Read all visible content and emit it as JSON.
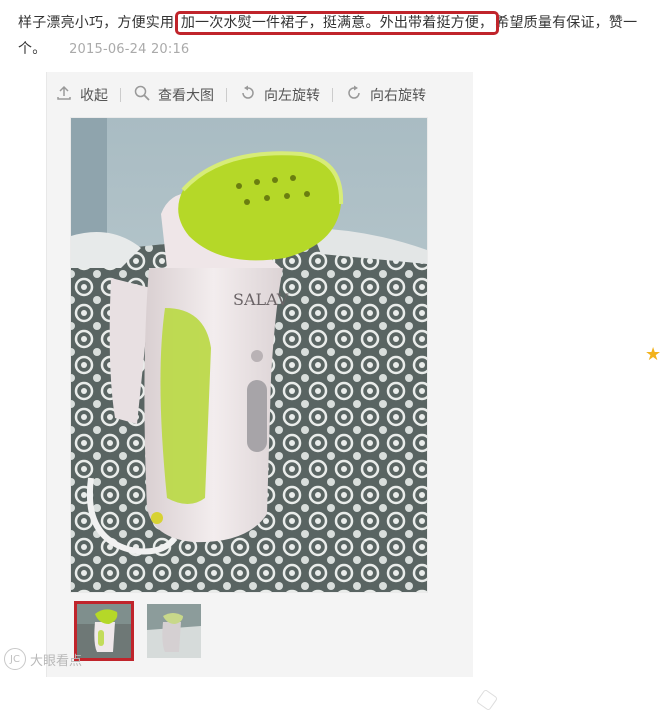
{
  "review": {
    "text_before": "样子漂亮小巧，方便实用",
    "highlight": "加一次水熨一件裙子，挺满意。外出带着挺方便，",
    "text_after": "希望质量有保证，赞一个。",
    "date": "2015-06-24 20:16"
  },
  "toolbar": {
    "collapse_label": "收起",
    "view_large_label": "查看大图",
    "rotate_left_label": "向左旋转",
    "rotate_right_label": "向右旋转"
  },
  "photo": {
    "brand_text": "SALAV",
    "alt": "steam iron product photo"
  },
  "thumbnails": [
    {
      "label": "thumb-1",
      "active": true
    },
    {
      "label": "thumb-2",
      "active": false
    }
  ],
  "watermark": {
    "logo": "JC",
    "text": "大眼看点"
  },
  "colors": {
    "highlight_border": "#c0242b",
    "iron_green": "#b9dc2a",
    "star": "#f2b21c"
  },
  "icons": {
    "collapse": "collapse-up-icon",
    "view_large": "magnifier-icon",
    "rotate_left": "rotate-left-icon",
    "rotate_right": "rotate-right-icon",
    "side": "star-icon"
  }
}
